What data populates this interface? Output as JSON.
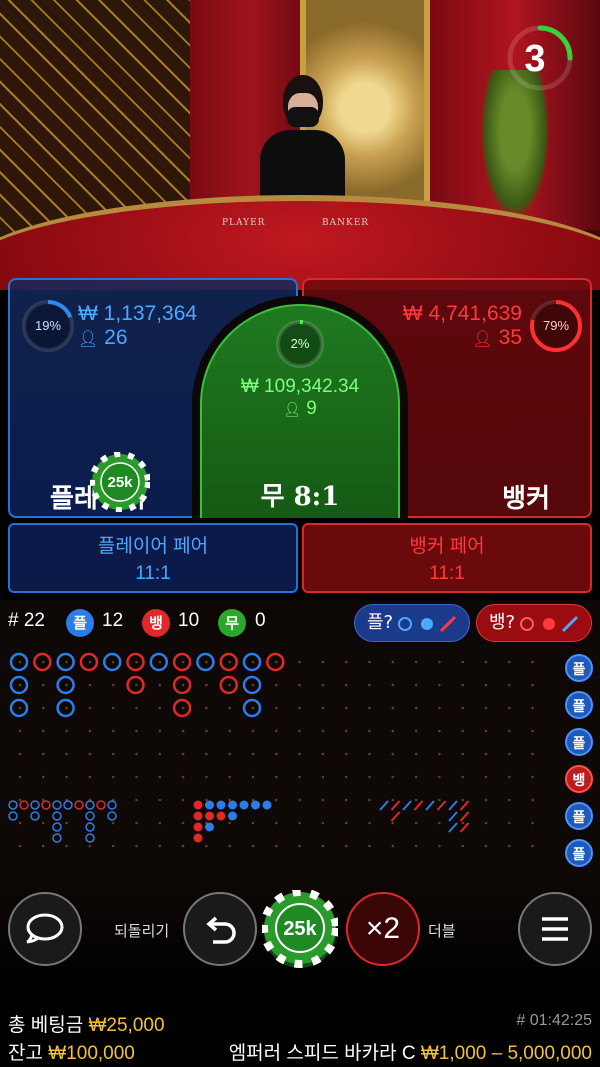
{
  "video": {
    "table_labels": [
      "PLAYER",
      "BANKER"
    ],
    "countdown": "3",
    "countdown_fraction": 0.25
  },
  "player": {
    "percent": "19%",
    "percent_value": 0.19,
    "amount": "₩ 1,137,364",
    "bettors": "26",
    "label": "플레이어",
    "chip": "25k",
    "color": "#2b6fd8"
  },
  "tie": {
    "percent": "2%",
    "percent_value": 0.02,
    "amount": "₩ 109,342.34",
    "bettors": "9",
    "label": "무 8:1",
    "color": "#3cc03c"
  },
  "banker": {
    "percent": "79%",
    "percent_value": 0.79,
    "amount": "₩ 4,741,639",
    "bettors": "35",
    "label": "뱅커",
    "color": "#e02828"
  },
  "pairs": {
    "player_name": "플레이어 페어",
    "player_odds": "11:1",
    "banker_name": "뱅커 페어",
    "banker_odds": "11:1"
  },
  "stats": {
    "round_prefix": "#",
    "round": "22",
    "player_badge": "플",
    "player_count": "12",
    "banker_badge": "뱅",
    "banker_count": "10",
    "tie_badge": "무",
    "tie_count": "0",
    "player_predict": "플?",
    "banker_predict": "뱅?"
  },
  "road": {
    "side_labels": [
      "플",
      "플",
      "플",
      "뱅",
      "플",
      "플"
    ],
    "big_road": [
      [
        "P",
        "P",
        "P"
      ],
      [
        "B"
      ],
      [
        "P",
        "P",
        "P"
      ],
      [
        "B"
      ],
      [
        "P"
      ],
      [
        "B",
        "B"
      ],
      [
        "P"
      ],
      [
        "B",
        "B",
        "B"
      ],
      [
        "P"
      ],
      [
        "B",
        "B"
      ],
      [
        "P",
        "P",
        "P"
      ],
      [
        "B"
      ]
    ]
  },
  "controls": {
    "undo_label": "되돌리기",
    "chip_value": "25k",
    "double_text": "×2",
    "double_label": "더블"
  },
  "footer": {
    "total_bet_label": "총 베팅금",
    "total_bet_value": "₩25,000",
    "balance_label": "잔고",
    "balance_value": "₩100,000",
    "game_id": "# 01:42:25",
    "table_name": "엠퍼러 스피드 바카라 C",
    "limits": "₩1,000 – 5,000,000"
  }
}
